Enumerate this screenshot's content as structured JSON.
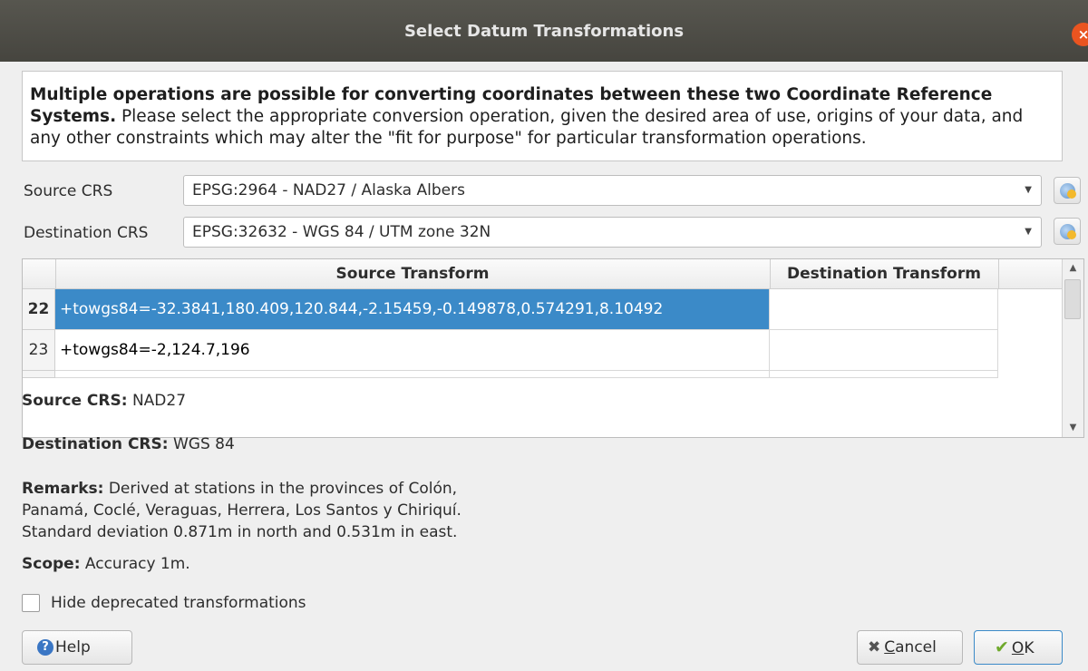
{
  "window": {
    "title": "Select Datum Transformations",
    "close_glyph": "×"
  },
  "info": {
    "bold_text": "Multiple operations are possible for converting coordinates between these two Coordinate Reference Systems.",
    "rest_text": " Please select the appropriate conversion operation, given the desired area of use, origins of your data, and any other constraints which may alter the \"fit for purpose\" for particular transformation operations."
  },
  "source_crs": {
    "label": "Source CRS",
    "value": "EPSG:2964 - NAD27 / Alaska Albers"
  },
  "destination_crs": {
    "label": "Destination CRS",
    "value": "EPSG:32632 - WGS 84 / UTM zone 32N"
  },
  "table": {
    "headers": [
      "Source Transform",
      "Destination Transform"
    ],
    "rows": [
      {
        "num": "22",
        "source": "+towgs84=-32.3841,180.409,120.844,-2.15459,-0.149878,0.574291,8.10492",
        "destination": "",
        "selected": true
      },
      {
        "num": "23",
        "source": "+towgs84=-2,124.7,196",
        "destination": "",
        "selected": false
      }
    ]
  },
  "details": {
    "source_crs_label": "Source CRS:",
    "source_crs_value": " NAD27",
    "dest_crs_label": "Destination CRS:",
    "dest_crs_value": " WGS 84",
    "remarks_label": "Remarks:",
    "remarks_line1": " Derived at stations in the provinces of Colón,",
    "remarks_line2": "Panamá, Coclé, Veraguas, Herrera, Los Santos y Chiriquí.",
    "remarks_line3": "Standard deviation 0.871m in north and 0.531m in east.",
    "scope_label": "Scope:",
    "scope_value": " Accuracy 1m."
  },
  "hide_deprecated": {
    "label": "Hide deprecated transformations",
    "checked": false
  },
  "buttons": {
    "help": "Help",
    "help_icon_glyph": "?",
    "cancel_underlined": "C",
    "cancel_rest": "ancel",
    "cancel_icon_glyph": "✖",
    "ok_underlined": "O",
    "ok_rest": "K",
    "ok_icon_glyph": "✔"
  },
  "colors": {
    "selection": "#3b8ac8",
    "titlebar": "#4e4d47",
    "close_button": "#e95420"
  }
}
